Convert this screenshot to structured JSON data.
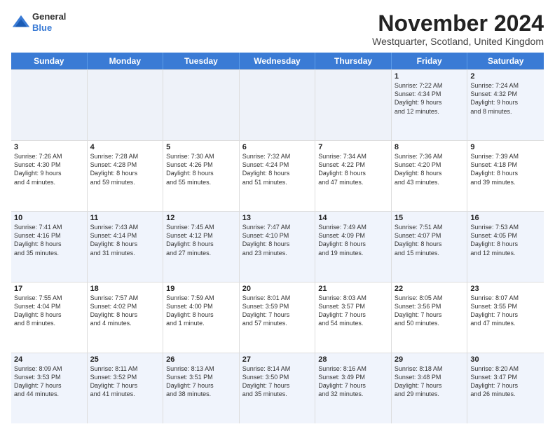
{
  "logo": {
    "line1": "General",
    "line2": "Blue"
  },
  "title": "November 2024",
  "location": "Westquarter, Scotland, United Kingdom",
  "header_days": [
    "Sunday",
    "Monday",
    "Tuesday",
    "Wednesday",
    "Thursday",
    "Friday",
    "Saturday"
  ],
  "rows": [
    [
      {
        "day": "",
        "info": ""
      },
      {
        "day": "",
        "info": ""
      },
      {
        "day": "",
        "info": ""
      },
      {
        "day": "",
        "info": ""
      },
      {
        "day": "",
        "info": ""
      },
      {
        "day": "1",
        "info": "Sunrise: 7:22 AM\nSunset: 4:34 PM\nDaylight: 9 hours\nand 12 minutes."
      },
      {
        "day": "2",
        "info": "Sunrise: 7:24 AM\nSunset: 4:32 PM\nDaylight: 9 hours\nand 8 minutes."
      }
    ],
    [
      {
        "day": "3",
        "info": "Sunrise: 7:26 AM\nSunset: 4:30 PM\nDaylight: 9 hours\nand 4 minutes."
      },
      {
        "day": "4",
        "info": "Sunrise: 7:28 AM\nSunset: 4:28 PM\nDaylight: 8 hours\nand 59 minutes."
      },
      {
        "day": "5",
        "info": "Sunrise: 7:30 AM\nSunset: 4:26 PM\nDaylight: 8 hours\nand 55 minutes."
      },
      {
        "day": "6",
        "info": "Sunrise: 7:32 AM\nSunset: 4:24 PM\nDaylight: 8 hours\nand 51 minutes."
      },
      {
        "day": "7",
        "info": "Sunrise: 7:34 AM\nSunset: 4:22 PM\nDaylight: 8 hours\nand 47 minutes."
      },
      {
        "day": "8",
        "info": "Sunrise: 7:36 AM\nSunset: 4:20 PM\nDaylight: 8 hours\nand 43 minutes."
      },
      {
        "day": "9",
        "info": "Sunrise: 7:39 AM\nSunset: 4:18 PM\nDaylight: 8 hours\nand 39 minutes."
      }
    ],
    [
      {
        "day": "10",
        "info": "Sunrise: 7:41 AM\nSunset: 4:16 PM\nDaylight: 8 hours\nand 35 minutes."
      },
      {
        "day": "11",
        "info": "Sunrise: 7:43 AM\nSunset: 4:14 PM\nDaylight: 8 hours\nand 31 minutes."
      },
      {
        "day": "12",
        "info": "Sunrise: 7:45 AM\nSunset: 4:12 PM\nDaylight: 8 hours\nand 27 minutes."
      },
      {
        "day": "13",
        "info": "Sunrise: 7:47 AM\nSunset: 4:10 PM\nDaylight: 8 hours\nand 23 minutes."
      },
      {
        "day": "14",
        "info": "Sunrise: 7:49 AM\nSunset: 4:09 PM\nDaylight: 8 hours\nand 19 minutes."
      },
      {
        "day": "15",
        "info": "Sunrise: 7:51 AM\nSunset: 4:07 PM\nDaylight: 8 hours\nand 15 minutes."
      },
      {
        "day": "16",
        "info": "Sunrise: 7:53 AM\nSunset: 4:05 PM\nDaylight: 8 hours\nand 12 minutes."
      }
    ],
    [
      {
        "day": "17",
        "info": "Sunrise: 7:55 AM\nSunset: 4:04 PM\nDaylight: 8 hours\nand 8 minutes."
      },
      {
        "day": "18",
        "info": "Sunrise: 7:57 AM\nSunset: 4:02 PM\nDaylight: 8 hours\nand 4 minutes."
      },
      {
        "day": "19",
        "info": "Sunrise: 7:59 AM\nSunset: 4:00 PM\nDaylight: 8 hours\nand 1 minute."
      },
      {
        "day": "20",
        "info": "Sunrise: 8:01 AM\nSunset: 3:59 PM\nDaylight: 7 hours\nand 57 minutes."
      },
      {
        "day": "21",
        "info": "Sunrise: 8:03 AM\nSunset: 3:57 PM\nDaylight: 7 hours\nand 54 minutes."
      },
      {
        "day": "22",
        "info": "Sunrise: 8:05 AM\nSunset: 3:56 PM\nDaylight: 7 hours\nand 50 minutes."
      },
      {
        "day": "23",
        "info": "Sunrise: 8:07 AM\nSunset: 3:55 PM\nDaylight: 7 hours\nand 47 minutes."
      }
    ],
    [
      {
        "day": "24",
        "info": "Sunrise: 8:09 AM\nSunset: 3:53 PM\nDaylight: 7 hours\nand 44 minutes."
      },
      {
        "day": "25",
        "info": "Sunrise: 8:11 AM\nSunset: 3:52 PM\nDaylight: 7 hours\nand 41 minutes."
      },
      {
        "day": "26",
        "info": "Sunrise: 8:13 AM\nSunset: 3:51 PM\nDaylight: 7 hours\nand 38 minutes."
      },
      {
        "day": "27",
        "info": "Sunrise: 8:14 AM\nSunset: 3:50 PM\nDaylight: 7 hours\nand 35 minutes."
      },
      {
        "day": "28",
        "info": "Sunrise: 8:16 AM\nSunset: 3:49 PM\nDaylight: 7 hours\nand 32 minutes."
      },
      {
        "day": "29",
        "info": "Sunrise: 8:18 AM\nSunset: 3:48 PM\nDaylight: 7 hours\nand 29 minutes."
      },
      {
        "day": "30",
        "info": "Sunrise: 8:20 AM\nSunset: 3:47 PM\nDaylight: 7 hours\nand 26 minutes."
      }
    ]
  ],
  "alt_rows": [
    0,
    2,
    4
  ],
  "colors": {
    "header_bg": "#3a7bd5",
    "header_text": "#ffffff",
    "alt_row_bg": "#e8eef8",
    "border": "#cccccc"
  }
}
